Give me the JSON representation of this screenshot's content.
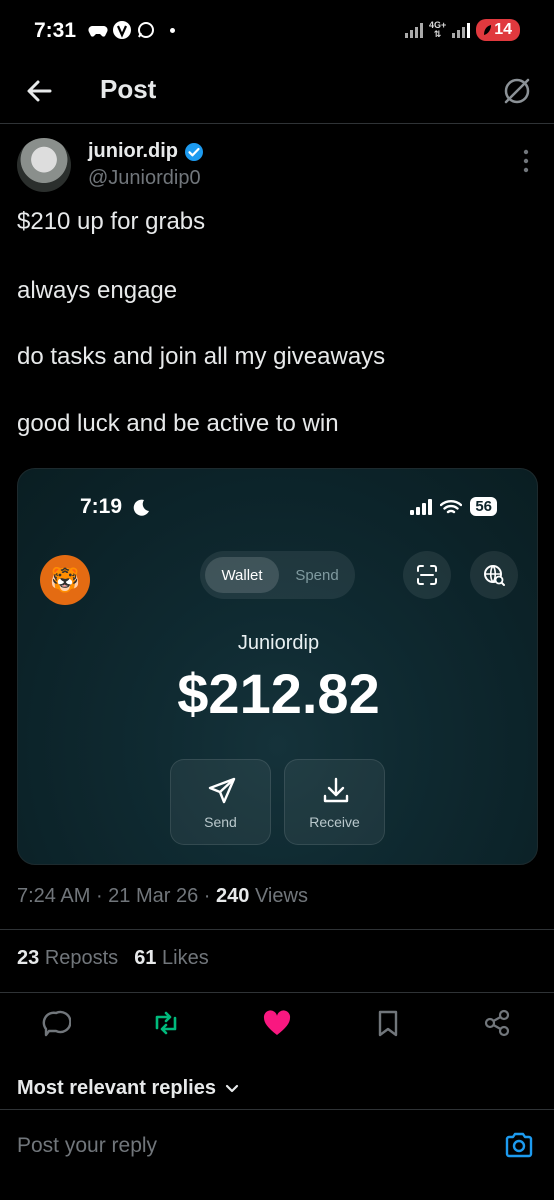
{
  "status_bar": {
    "time": "7:31",
    "network": "4G+",
    "battery": "14"
  },
  "header": {
    "title": "Post"
  },
  "author": {
    "name": "junior.dip",
    "handle": "@Juniordip0",
    "verified": true
  },
  "post": {
    "paragraphs": [
      "$210 up for grabs",
      "always engage",
      "do tasks and join all my giveaways",
      "good luck and be active to win"
    ]
  },
  "media": {
    "status_time": "7:19",
    "battery": "56",
    "tabs": {
      "active": "Wallet",
      "inactive": "Spend"
    },
    "wallet_name": "Juniordip",
    "balance": "$212.82",
    "send_label": "Send",
    "receive_label": "Receive"
  },
  "meta": {
    "time": "7:24 AM",
    "date": "21 Mar 26",
    "views_count": "240",
    "views_label": "Views"
  },
  "stats": {
    "reposts_count": "23",
    "reposts_label": "Reposts",
    "likes_count": "61",
    "likes_label": "Likes"
  },
  "replies": {
    "sort_label": "Most relevant replies",
    "placeholder": "Post your reply"
  },
  "colors": {
    "background": "#000000",
    "text": "#e7e9ea",
    "muted": "#71767b",
    "verified": "#1d9bf0",
    "repost": "#00ba7c",
    "like": "#f91880",
    "card": "#0c2329"
  }
}
